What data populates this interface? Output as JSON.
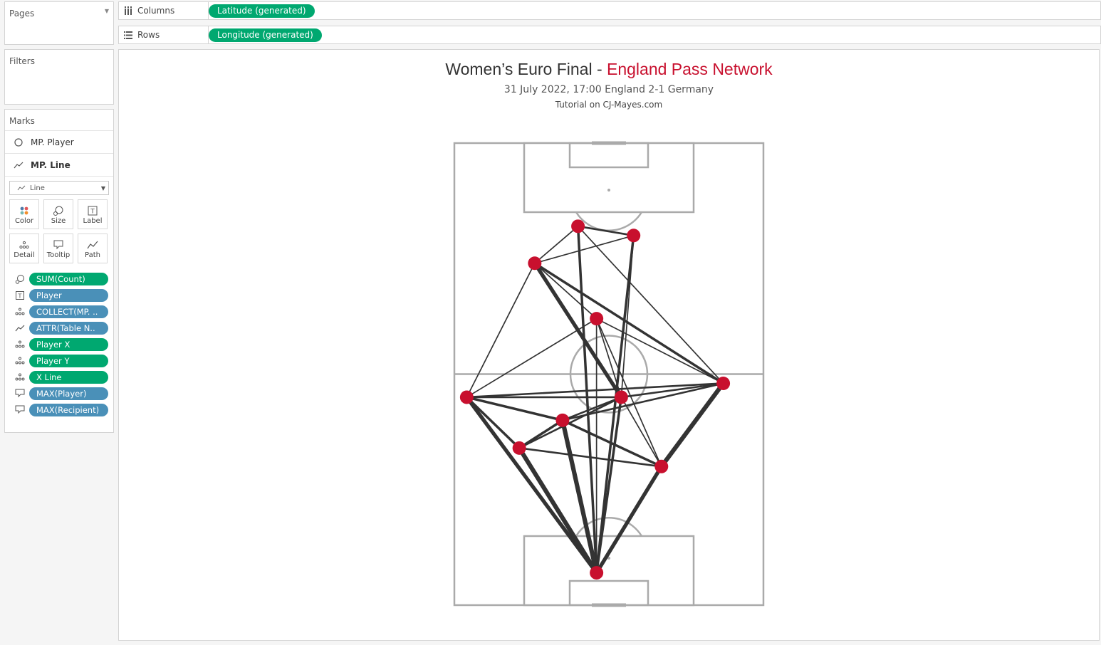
{
  "left_panel": {
    "pages": {
      "title": "Pages"
    },
    "filters": {
      "title": "Filters"
    },
    "marks": {
      "title": "Marks",
      "layers": [
        {
          "label": "MP. Player",
          "icon": "circle-icon"
        },
        {
          "label": "MP. Line",
          "icon": "line-icon"
        }
      ],
      "mark_type": "Line",
      "buttons": [
        {
          "label": "Color",
          "icon": "color-icon"
        },
        {
          "label": "Size",
          "icon": "size-icon"
        },
        {
          "label": "Label",
          "icon": "label-icon"
        },
        {
          "label": "Detail",
          "icon": "detail-icon"
        },
        {
          "label": "Tooltip",
          "icon": "tooltip-icon"
        },
        {
          "label": "Path",
          "icon": "path-icon"
        }
      ],
      "pills": [
        {
          "label": "SUM(Count)",
          "icon": "size-icon",
          "color": "#00a870"
        },
        {
          "label": "Player",
          "icon": "label-icon",
          "color": "#4a90b8"
        },
        {
          "label": "COLLECT(MP. ..",
          "icon": "detail-icon",
          "color": "#4a90b8"
        },
        {
          "label": "ATTR(Table N..",
          "icon": "path-icon",
          "color": "#4a90b8"
        },
        {
          "label": "Player X",
          "icon": "detail-icon",
          "color": "#00a870"
        },
        {
          "label": "Player Y",
          "icon": "detail-icon",
          "color": "#00a870"
        },
        {
          "label": "X Line",
          "icon": "detail-icon",
          "color": "#00a870"
        },
        {
          "label": "MAX(Player)",
          "icon": "tooltip-icon",
          "color": "#4a90b8"
        },
        {
          "label": "MAX(Recipient)",
          "icon": "tooltip-icon",
          "color": "#4a90b8"
        }
      ]
    }
  },
  "shelves": {
    "columns": {
      "label": "Columns",
      "pill": "Latitude (generated)"
    },
    "rows": {
      "label": "Rows",
      "pill": "Longitude (generated)"
    }
  },
  "viz": {
    "title_main": "Women’s Euro Final - ",
    "title_accent": "England Pass Network",
    "subtitle": "31 July 2022, 17:00 England 2-1 Germany",
    "tutorial": "Tutorial on CJ-Mayes.com",
    "node_color": "#c8102e",
    "line_color": "#333333",
    "pitch_line_color": "#aaaaaa"
  },
  "chart_data": {
    "type": "network",
    "nodes": [
      {
        "id": 1,
        "x": 0.4,
        "y": 0.18
      },
      {
        "id": 2,
        "x": 0.58,
        "y": 0.2
      },
      {
        "id": 3,
        "x": 0.26,
        "y": 0.26
      },
      {
        "id": 4,
        "x": 0.46,
        "y": 0.38
      },
      {
        "id": 5,
        "x": 0.87,
        "y": 0.52
      },
      {
        "id": 6,
        "x": 0.04,
        "y": 0.55
      },
      {
        "id": 7,
        "x": 0.54,
        "y": 0.55
      },
      {
        "id": 8,
        "x": 0.35,
        "y": 0.6
      },
      {
        "id": 9,
        "x": 0.21,
        "y": 0.66
      },
      {
        "id": 10,
        "x": 0.67,
        "y": 0.7
      },
      {
        "id": 11,
        "x": 0.46,
        "y": 0.93
      }
    ],
    "edges": [
      {
        "from": 1,
        "to": 2,
        "count": 2
      },
      {
        "from": 1,
        "to": 3,
        "count": 1
      },
      {
        "from": 1,
        "to": 11,
        "count": 3
      },
      {
        "from": 1,
        "to": 5,
        "count": 1
      },
      {
        "from": 2,
        "to": 3,
        "count": 1
      },
      {
        "from": 2,
        "to": 11,
        "count": 3
      },
      {
        "from": 2,
        "to": 7,
        "count": 1
      },
      {
        "from": 3,
        "to": 7,
        "count": 5
      },
      {
        "from": 3,
        "to": 5,
        "count": 3
      },
      {
        "from": 3,
        "to": 4,
        "count": 1
      },
      {
        "from": 3,
        "to": 6,
        "count": 1
      },
      {
        "from": 4,
        "to": 6,
        "count": 1
      },
      {
        "from": 4,
        "to": 10,
        "count": 1
      },
      {
        "from": 4,
        "to": 11,
        "count": 1
      },
      {
        "from": 4,
        "to": 7,
        "count": 1
      },
      {
        "from": 4,
        "to": 5,
        "count": 1
      },
      {
        "from": 5,
        "to": 6,
        "count": 2
      },
      {
        "from": 5,
        "to": 7,
        "count": 2
      },
      {
        "from": 5,
        "to": 8,
        "count": 2
      },
      {
        "from": 5,
        "to": 10,
        "count": 6
      },
      {
        "from": 6,
        "to": 7,
        "count": 2
      },
      {
        "from": 6,
        "to": 8,
        "count": 3
      },
      {
        "from": 6,
        "to": 9,
        "count": 3
      },
      {
        "from": 6,
        "to": 11,
        "count": 5
      },
      {
        "from": 7,
        "to": 9,
        "count": 2
      },
      {
        "from": 7,
        "to": 8,
        "count": 2
      },
      {
        "from": 7,
        "to": 11,
        "count": 3
      },
      {
        "from": 7,
        "to": 10,
        "count": 1
      },
      {
        "from": 8,
        "to": 9,
        "count": 3
      },
      {
        "from": 8,
        "to": 10,
        "count": 3
      },
      {
        "from": 8,
        "to": 11,
        "count": 6
      },
      {
        "from": 9,
        "to": 11,
        "count": 6
      },
      {
        "from": 9,
        "to": 10,
        "count": 2
      },
      {
        "from": 10,
        "to": 11,
        "count": 5
      }
    ]
  }
}
